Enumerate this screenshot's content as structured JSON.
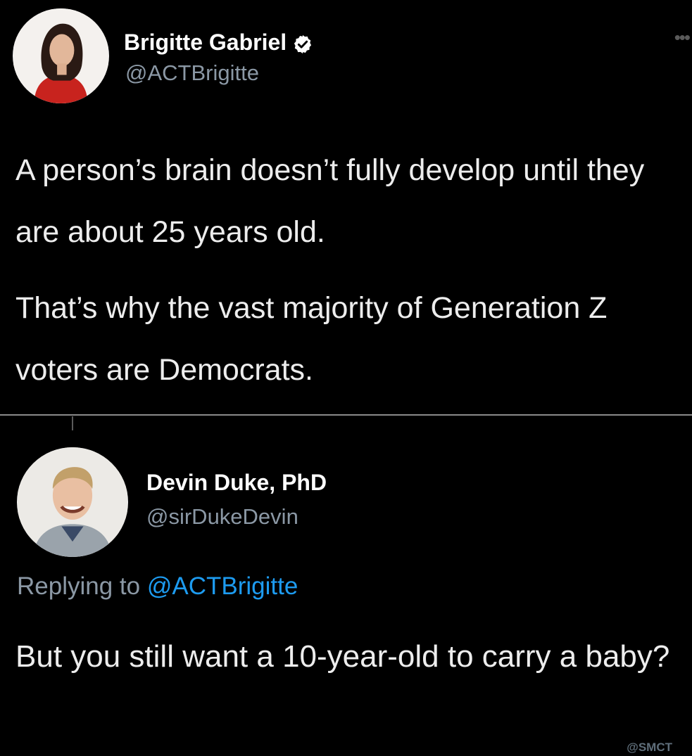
{
  "tweet": {
    "author": {
      "name": "Brigitte Gabriel",
      "handle": "@ACTBrigitte",
      "verified": true
    },
    "more_icon": "more-dots-icon",
    "text_paragraphs": [
      "A person’s brain doesn’t fully develop until they are about 25 years old.",
      "That’s why the vast majority of Generation Z voters are Democrats."
    ]
  },
  "reply": {
    "author": {
      "name": "Devin Duke, PhD",
      "handle": "@sirDukeDevin"
    },
    "replying_prefix": "Replying to",
    "replying_to": "@ACTBrigitte",
    "text": "But you still want a 10-year-old to carry a baby?"
  },
  "watermark": "@SMCT",
  "colors": {
    "background": "#000000",
    "text": "#ededed",
    "secondary_text": "#8b98a5",
    "link": "#1d9bf0",
    "verified_badge": "#1d9bf0"
  }
}
